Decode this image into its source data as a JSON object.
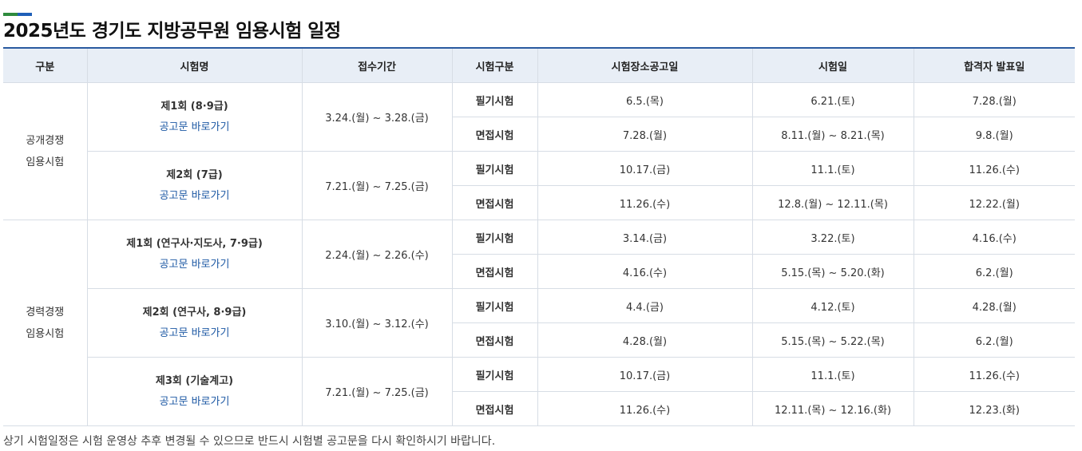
{
  "page_title": "2025년도 경기도 지방공무원 임용시험 일정",
  "colors": {
    "accent_green": "#2e8b3d",
    "accent_blue": "#1f5fb8",
    "header_bg": "#e8eef6",
    "link": "#1b57a3"
  },
  "table": {
    "headers": [
      "구분",
      "시험명",
      "접수기간",
      "시험구분",
      "시험장소공고일",
      "시험일",
      "합격자 발표일"
    ],
    "categories": [
      {
        "line1": "공개경쟁",
        "line2": "임용시험"
      },
      {
        "line1": "경력경쟁",
        "line2": "임용시험"
      }
    ],
    "exams": [
      {
        "name": "제1회 (8·9급)",
        "link": "공고문 바로가기",
        "period": "3.24.(월) ~ 3.28.(금)",
        "rows": [
          {
            "type": "필기시험",
            "venue": "6.5.(목)",
            "date": "6.21.(토)",
            "result": "7.28.(월)"
          },
          {
            "type": "면접시험",
            "venue": "7.28.(월)",
            "date": "8.11.(월) ~ 8.21.(목)",
            "result": "9.8.(월)"
          }
        ]
      },
      {
        "name": "제2회 (7급)",
        "link": "공고문 바로가기",
        "period": "7.21.(월) ~ 7.25.(금)",
        "rows": [
          {
            "type": "필기시험",
            "venue": "10.17.(금)",
            "date": "11.1.(토)",
            "result": "11.26.(수)"
          },
          {
            "type": "면접시험",
            "venue": "11.26.(수)",
            "date": "12.8.(월) ~ 12.11.(목)",
            "result": "12.22.(월)"
          }
        ]
      },
      {
        "name": "제1회 (연구사·지도사, 7·9급)",
        "link": "공고문 바로가기",
        "period": "2.24.(월) ~ 2.26.(수)",
        "rows": [
          {
            "type": "필기시험",
            "venue": "3.14.(금)",
            "date": "3.22.(토)",
            "result": "4.16.(수)"
          },
          {
            "type": "면접시험",
            "venue": "4.16.(수)",
            "date": "5.15.(목) ~ 5.20.(화)",
            "result": "6.2.(월)"
          }
        ]
      },
      {
        "name": "제2회 (연구사, 8·9급)",
        "link": "공고문 바로가기",
        "period": "3.10.(월) ~ 3.12.(수)",
        "rows": [
          {
            "type": "필기시험",
            "venue": "4.4.(금)",
            "date": "4.12.(토)",
            "result": "4.28.(월)"
          },
          {
            "type": "면접시험",
            "venue": "4.28.(월)",
            "date": "5.15.(목) ~ 5.22.(목)",
            "result": "6.2.(월)"
          }
        ]
      },
      {
        "name": "제3회 (기술계고)",
        "link": "공고문 바로가기",
        "period": "7.21.(월) ~ 7.25.(금)",
        "rows": [
          {
            "type": "필기시험",
            "venue": "10.17.(금)",
            "date": "11.1.(토)",
            "result": "11.26.(수)"
          },
          {
            "type": "면접시험",
            "venue": "11.26.(수)",
            "date": "12.11.(목) ~ 12.16.(화)",
            "result": "12.23.(화)"
          }
        ]
      }
    ]
  },
  "footnote": "상기 시험일정은 시험 운영상 추후 변경될 수 있으므로 반드시 시험별 공고문을 다시 확인하시기 바랍니다."
}
